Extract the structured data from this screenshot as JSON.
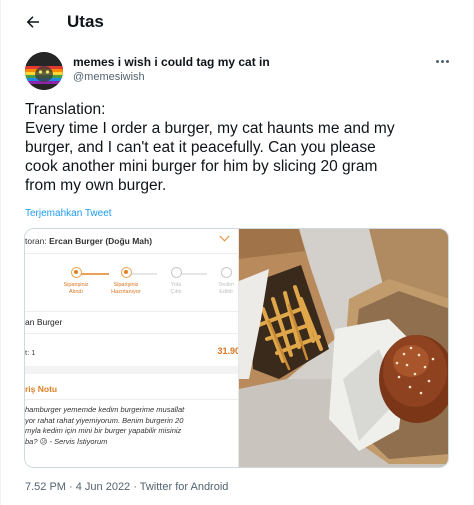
{
  "header": {
    "title": "Utas"
  },
  "tweet": {
    "display_name": "memes i wish i could tag my cat in",
    "handle": "@memesiwish",
    "text_lines": [
      "Translation:",
      "Every time I order a burger, my cat haunts me and my",
      "burger, and I can't eat it peacefully. Can you please",
      "cook another mini burger for him by slicing 20 gram",
      "from my own burger."
    ],
    "translate_label": "Terjemahkan Tweet",
    "timestamp": "7.52 PM · 4 Jun 2022 · Twitter for Android"
  },
  "order_screenshot": {
    "restaurant_prefix": "toran: ",
    "restaurant_name": "Ercan Burger (Doğu Mah)",
    "steps": [
      {
        "line1": "Siparişiniz",
        "line2": "Alındı",
        "done": true
      },
      {
        "line1": "Siparişiniz",
        "line2": "Hazırlanıyor",
        "done": true
      },
      {
        "line1": "Yola",
        "line2": "Çıktı",
        "done": false
      },
      {
        "line1": "Teslim",
        "line2": "Edildi",
        "done": false
      }
    ],
    "item_name": "an Burger",
    "item_qty": "t: 1",
    "item_price": "31.90",
    "note_title": "riş Notu",
    "note_lines": [
      "hamburger yememde kedim burgerime musallat",
      "yor rahat rahat yiyemiyorum. Benim burgerin 20",
      "myla kedim için mini bir burger yapabilir misiniz",
      "ba? 😥 - Servis İstiyorum"
    ]
  },
  "icons": {
    "back": "arrow-left-icon",
    "more": "more-horizontal-icon"
  },
  "colors": {
    "link": "#1d9bf0",
    "accent_orange": "#e07f24",
    "text_secondary": "#536471"
  }
}
